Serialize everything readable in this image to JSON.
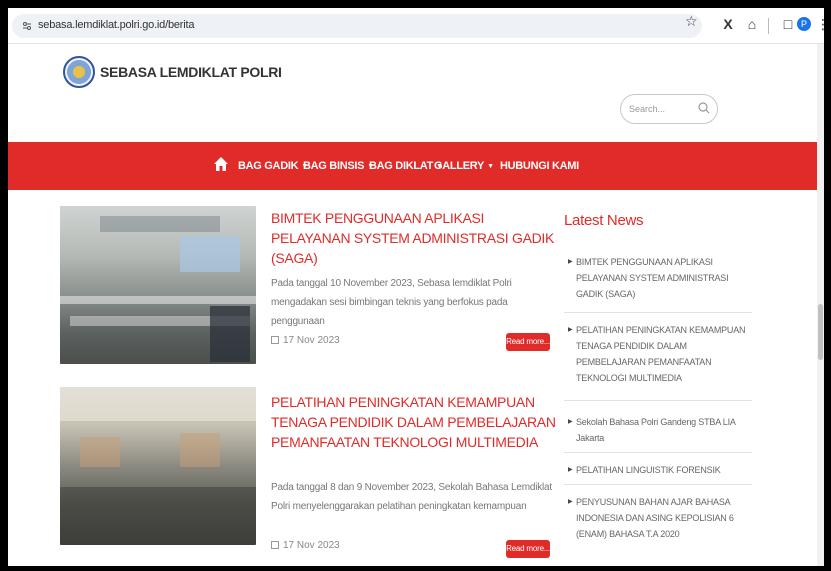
{
  "browser": {
    "url": "sebasa.lemdiklat.polri.go.id/berita",
    "profile_initial": "P"
  },
  "site": {
    "name": "SEBASA LEMDIKLAT POLRI",
    "search_placeholder": "Search..."
  },
  "nav": {
    "items": [
      {
        "label": "BAG GADIK",
        "has_dropdown": true
      },
      {
        "label": "BAG BINSIS",
        "has_dropdown": true
      },
      {
        "label": "BAG DIKLAT",
        "has_dropdown": true
      },
      {
        "label": "GALLERY",
        "has_dropdown": true
      },
      {
        "label": "HUBUNGI KAMI",
        "has_dropdown": false
      }
    ]
  },
  "articles": [
    {
      "title": "BIMTEK PENGGUNAAN APLIKASI PELAYANAN SYSTEM ADMINISTRASI GADIK (SAGA)",
      "excerpt": "Pada tanggal 10 November 2023, Sebasa lemdiklat Polri mengadakan sesi bimbingan teknis yang berfokus pada penggunaan",
      "date": "17 Nov 2023",
      "read_more": "Read more..."
    },
    {
      "title": "PELATIHAN PENINGKATAN KEMAMPUAN TENAGA PENDIDIK DALAM PEMBELAJARAN PEMANFAATAN TEKNOLOGI MULTIMEDIA",
      "excerpt": "Pada tanggal 8 dan 9 November 2023, Sekolah Bahasa Lemdiklat Polri menyelenggarakan pelatihan peningkatan kemampuan",
      "date": "17 Nov 2023",
      "read_more": "Read more..."
    }
  ],
  "sidebar": {
    "title": "Latest News",
    "items": [
      "BIMTEK PENGGUNAAN APLIKASI PELAYANAN SYSTEM ADMINISTRASI GADIK (SAGA)",
      "PELATIHAN PENINGKATAN KEMAMPUAN TENAGA PENDIDIK DALAM PEMBELAJARAN PEMANFAATAN TEKNOLOGI MULTIMEDIA",
      "Sekolah Bahasa Polri Gandeng STBA LIA Jakarta",
      "PELATIHAN LINGUISTIK FORENSIK",
      "PENYUSUNAN BAHAN AJAR BAHASA INDONESIA DAN ASING KEPOLISIAN 6 (ENAM) BAHASA T.A 2020"
    ]
  },
  "colors": {
    "accent": "#e02b29",
    "text_muted": "#777777"
  }
}
